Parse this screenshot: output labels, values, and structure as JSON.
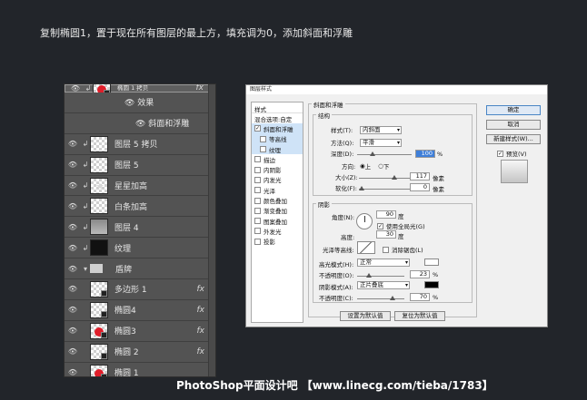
{
  "instruction": "复制椭圆1，置于现在所有图层的最上方，填充调为0，添加斜面和浮雕",
  "layers": {
    "rows": [
      {
        "name": "椭圆 1 拷贝",
        "fx": "fx"
      },
      {
        "name": "效果"
      },
      {
        "name": "斜面和浮雕"
      },
      {
        "name": "图层 5 拷贝"
      },
      {
        "name": "图层 5"
      },
      {
        "name": "星星加高"
      },
      {
        "name": "白条加高"
      },
      {
        "name": "图层 4"
      },
      {
        "name": "纹理"
      },
      {
        "name": "盾牌"
      },
      {
        "name": "多边形 1",
        "fx": "fx"
      },
      {
        "name": "椭圆4",
        "fx": "fx"
      },
      {
        "name": "椭圆3",
        "fx": "fx"
      },
      {
        "name": "椭圆 2",
        "fx": "fx"
      },
      {
        "name": "椭圆 1"
      }
    ]
  },
  "dialog": {
    "title": "图层样式",
    "styles_header": "样式",
    "blend_options": "混合选项:自定",
    "style_items": [
      "斜面和浮雕",
      "等高线",
      "纹理",
      "描边",
      "内阴影",
      "内发光",
      "光泽",
      "颜色叠加",
      "渐变叠加",
      "图案叠加",
      "外发光",
      "投影"
    ],
    "section_title": "斜面和浮雕",
    "structure": {
      "label": "结构",
      "style_label": "样式(T):",
      "style_value": "内斜面",
      "method_label": "方法(Q):",
      "method_value": "平滑",
      "depth_label": "深度(D):",
      "depth_value": "100",
      "depth_unit": "%",
      "direction_label": "方向:",
      "direction_up": "上",
      "direction_down": "下",
      "size_label": "大小(Z):",
      "size_value": "117",
      "size_unit": "像素",
      "soften_label": "软化(F):",
      "soften_value": "0",
      "soften_unit": "像素"
    },
    "shading": {
      "label": "阴影",
      "angle_label": "角度(N):",
      "angle_value": "90",
      "angle_unit": "度",
      "global_light": "使用全局光(G)",
      "altitude_label": "高度:",
      "altitude_value": "30",
      "altitude_unit": "度",
      "gloss_label": "光泽等高线:",
      "anti_alias": "消除锯齿(L)",
      "highlight_label": "高光模式(H):",
      "highlight_mode": "正常",
      "opacity1_label": "不透明度(O):",
      "opacity1_value": "23",
      "percent": "%",
      "shadow_label": "阴影模式(A):",
      "shadow_mode": "正片叠底",
      "opacity2_label": "不透明度(C):",
      "opacity2_value": "70",
      "highlight_color": "#ffffff",
      "shadow_color": "#000000"
    },
    "buttons": {
      "ok": "确定",
      "cancel": "取消",
      "new_style": "新建样式(W)...",
      "preview": "预览(V)",
      "set_default": "设置为默认值",
      "reset_default": "复位为默认值"
    }
  },
  "footer": "PhotoShop平面设计吧 【www.linecg.com/tieba/1783】"
}
